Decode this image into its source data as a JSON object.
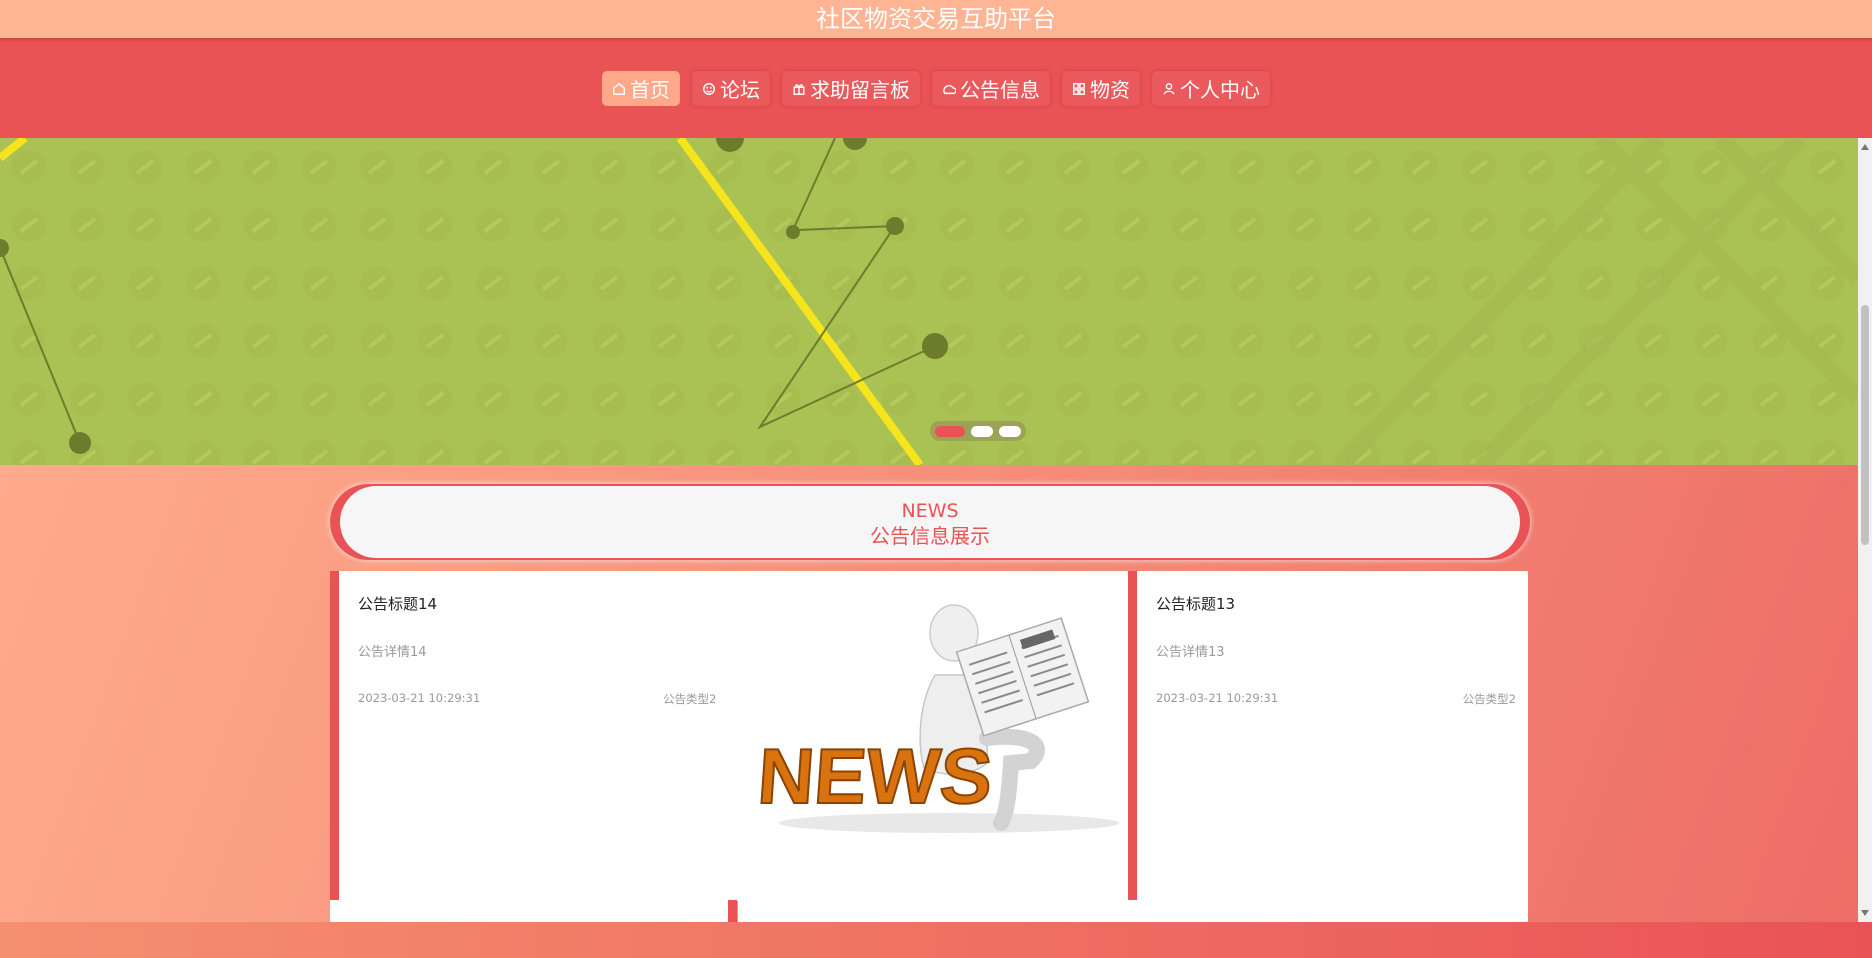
{
  "app": {
    "title": "社区物资交易互助平台"
  },
  "nav": {
    "items": [
      {
        "label": "首页",
        "icon": "home-icon",
        "active": true
      },
      {
        "label": "论坛",
        "icon": "smile-icon",
        "active": false
      },
      {
        "label": "求助留言板",
        "icon": "gift-icon",
        "active": false
      },
      {
        "label": "公告信息",
        "icon": "cloud-icon",
        "active": false
      },
      {
        "label": "物资",
        "icon": "grid-icon",
        "active": false
      },
      {
        "label": "个人中心",
        "icon": "user-icon",
        "active": false
      }
    ]
  },
  "banner": {
    "slide_count": 3,
    "active_slide": 1,
    "colors": {
      "background": "#aac153",
      "active_dot": "#ea5356"
    }
  },
  "news": {
    "heading_en": "NEWS",
    "heading_cn": "公告信息展示",
    "items": [
      {
        "title": "公告标题14",
        "detail": "公告详情14",
        "time": "2023-03-21 10:29:31",
        "type": "公告类型2",
        "image_caption": "NEWS"
      },
      {
        "title": "公告标题13",
        "detail": "公告详情13",
        "time": "2023-03-21 10:29:31",
        "type": "公告类型2"
      }
    ]
  },
  "colors": {
    "primary": "#ea5356",
    "header": "#ffb593",
    "card": "#ffffff"
  }
}
